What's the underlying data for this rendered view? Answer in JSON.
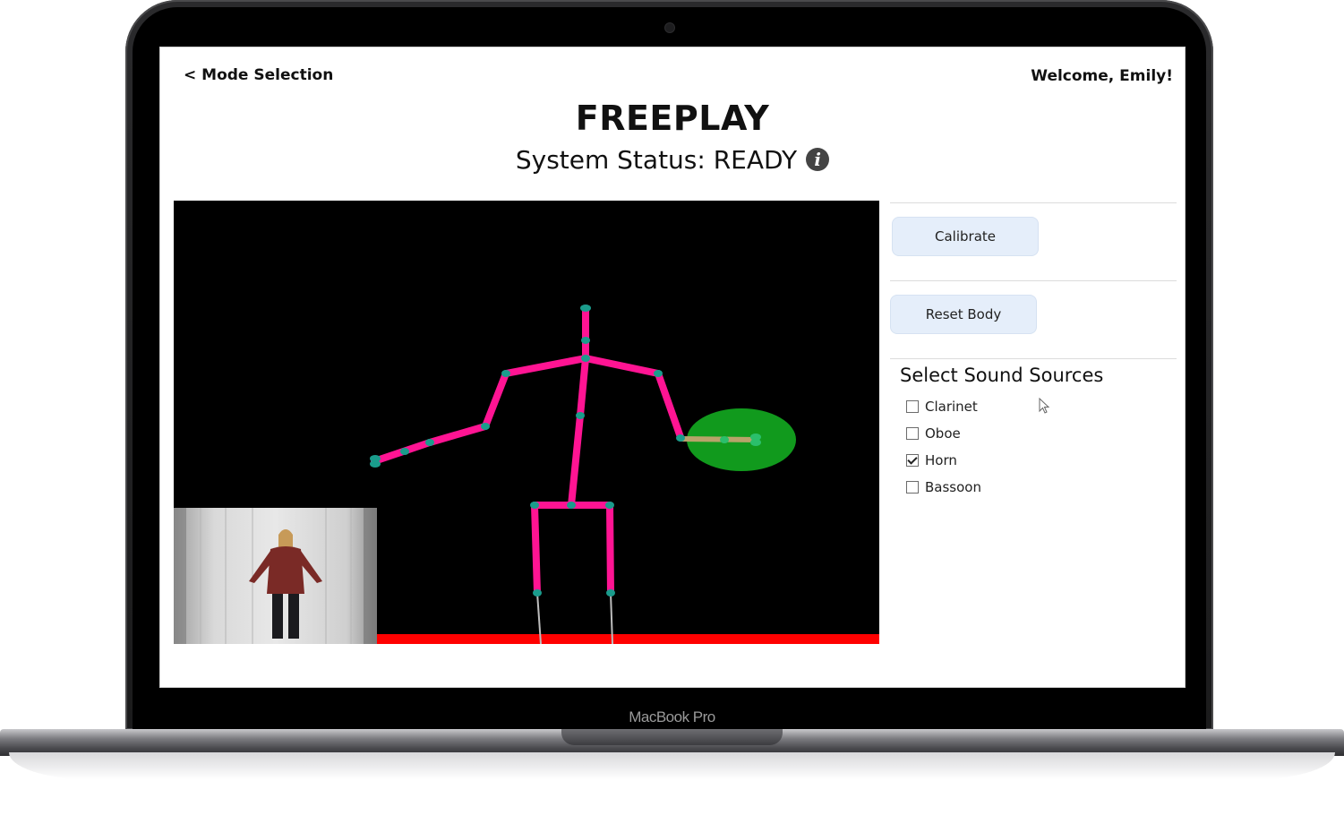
{
  "device": {
    "brand": "MacBook Pro"
  },
  "header": {
    "back_label": "< Mode Selection",
    "welcome": "Welcome, Emily!"
  },
  "page": {
    "title": "FREEPLAY",
    "status": "System Status: READY",
    "info_icon": "info-icon"
  },
  "controls": {
    "calibrate_label": "Calibrate",
    "reset_label": "Reset Body",
    "sources_title": "Select Sound Sources",
    "sources": [
      {
        "label": "Clarinet",
        "checked": false
      },
      {
        "label": "Oboe",
        "checked": false
      },
      {
        "label": "Horn",
        "checked": true
      },
      {
        "label": "Bassoon",
        "checked": false
      }
    ]
  },
  "colors": {
    "skeleton": "#ff1493",
    "joint": "#1a9c8c",
    "target": "#119a1d",
    "floor": "#ff0000",
    "button_bg": "#e5eefa"
  }
}
